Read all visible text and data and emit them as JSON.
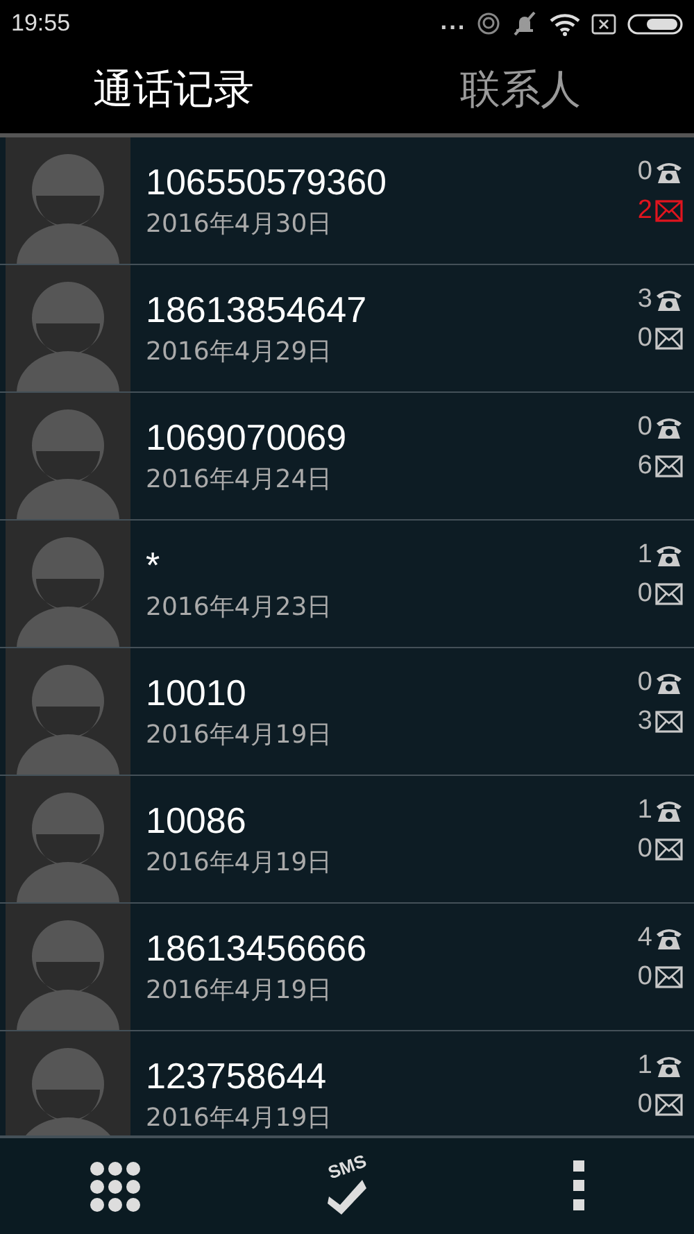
{
  "status_bar": {
    "time": "19:55",
    "more": "..."
  },
  "tabs": [
    {
      "label": "通话记录",
      "selected": true
    },
    {
      "label": "联系人",
      "selected": false
    }
  ],
  "entries": [
    {
      "number": "106550579360",
      "date": "2016年4月30日",
      "calls": "0",
      "messages": "2",
      "messages_unread": true
    },
    {
      "number": "18613854647",
      "date": "2016年4月29日",
      "calls": "3",
      "messages": "0",
      "messages_unread": false
    },
    {
      "number": "1069070069",
      "date": "2016年4月24日",
      "calls": "0",
      "messages": "6",
      "messages_unread": false
    },
    {
      "number": "*",
      "date": "2016年4月23日",
      "calls": "1",
      "messages": "0",
      "messages_unread": false
    },
    {
      "number": "10010",
      "date": "2016年4月19日",
      "calls": "0",
      "messages": "3",
      "messages_unread": false
    },
    {
      "number": "10086",
      "date": "2016年4月19日",
      "calls": "1",
      "messages": "0",
      "messages_unread": false
    },
    {
      "number": "18613456666",
      "date": "2016年4月19日",
      "calls": "4",
      "messages": "0",
      "messages_unread": false
    },
    {
      "number": "123758644",
      "date": "2016年4月19日",
      "calls": "1",
      "messages": "0",
      "messages_unread": false
    }
  ],
  "bottom_bar": {
    "sms_label": "SMS"
  }
}
